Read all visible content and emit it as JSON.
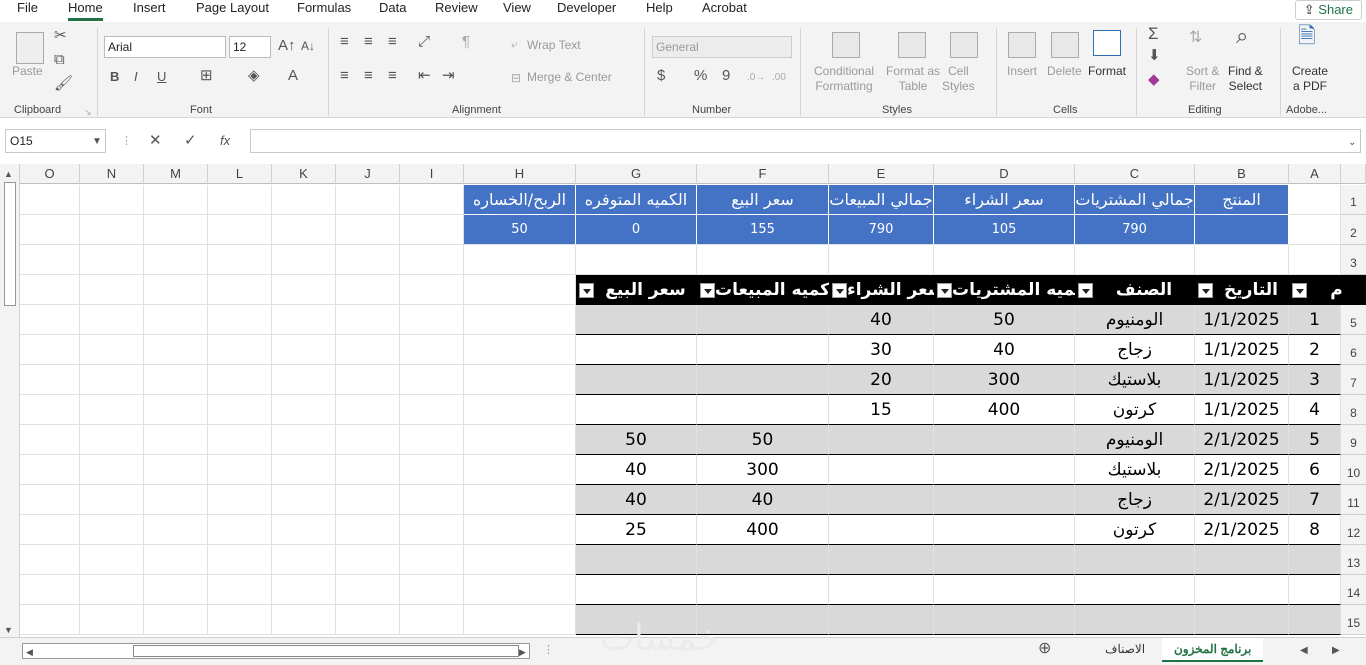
{
  "menu": {
    "items": [
      "File",
      "Home",
      "Insert",
      "Page Layout",
      "Formulas",
      "Data",
      "Review",
      "View",
      "Developer",
      "Help",
      "Acrobat"
    ],
    "active": "Home",
    "share_label": "Share"
  },
  "ribbon": {
    "clipboard": {
      "paste": "Paste",
      "label": "Clipboard"
    },
    "font": {
      "name": "Arial",
      "size": "12",
      "label": "Font",
      "bold": "B",
      "italic": "I",
      "underline": "U"
    },
    "alignment": {
      "wrap_text": "Wrap Text",
      "merge_center": "Merge & Center",
      "label": "Alignment"
    },
    "number": {
      "format": "General",
      "currency": "$",
      "percent": "%",
      "comma": "9",
      "label": "Number"
    },
    "styles": {
      "conditional": "Conditional",
      "formatting": "Formatting",
      "format_as": "Format as",
      "table": "Table",
      "cell": "Cell",
      "styles_word": "Styles",
      "label": "Styles"
    },
    "cells": {
      "insert": "Insert",
      "delete": "Delete",
      "format": "Format",
      "label": "Cells"
    },
    "editing": {
      "sort": "Sort &",
      "filter": "Filter",
      "find": "Find &",
      "select": "Select",
      "label": "Editing"
    },
    "adobe": {
      "create": "Create",
      "pdf": "a PDF",
      "label": "Adobe..."
    }
  },
  "formula_bar": {
    "name_box": "O15",
    "fx": "fx",
    "cancel": "✕",
    "enter": "✓",
    "content": ""
  },
  "columns": [
    "O",
    "N",
    "M",
    "L",
    "K",
    "J",
    "I",
    "H",
    "G",
    "F",
    "E",
    "D",
    "C",
    "B",
    "A"
  ],
  "rows": [
    "1",
    "2",
    "3",
    "4",
    "5",
    "6",
    "7",
    "8",
    "9",
    "10",
    "11",
    "12",
    "13",
    "14",
    "15"
  ],
  "summary": {
    "headers": [
      "الربح/الخساره",
      "الكميه المتوفره",
      "سعر البيع",
      "جمالي المبيعات",
      "سعر الشراء",
      "جمالي المشتريات",
      "المنتج"
    ],
    "values": [
      "50",
      "0",
      "155",
      "790",
      "105",
      "790",
      ""
    ]
  },
  "table": {
    "headers": [
      "م",
      "التاريخ",
      "الصنف",
      "كميه المشتريات",
      "سعر الشراء",
      "كميه المبيعات",
      "سعر البيع"
    ],
    "rows": [
      [
        "1",
        "1/1/2025",
        "الومنيوم",
        "50",
        "40",
        "",
        ""
      ],
      [
        "2",
        "1/1/2025",
        "زجاج",
        "40",
        "30",
        "",
        ""
      ],
      [
        "3",
        "1/1/2025",
        "بلاستيك",
        "300",
        "20",
        "",
        ""
      ],
      [
        "4",
        "1/1/2025",
        "كرتون",
        "400",
        "15",
        "",
        ""
      ],
      [
        "5",
        "2/1/2025",
        "الومنيوم",
        "",
        "",
        "50",
        "50"
      ],
      [
        "6",
        "2/1/2025",
        "بلاستيك",
        "",
        "",
        "300",
        "40"
      ],
      [
        "7",
        "2/1/2025",
        "زجاج",
        "",
        "",
        "40",
        "40"
      ],
      [
        "8",
        "2/1/2025",
        "كرتون",
        "",
        "",
        "400",
        "25"
      ]
    ]
  },
  "sheets": {
    "active": "برنامج المخزون",
    "other": "الاصناف"
  },
  "watermark": "خمسات"
}
